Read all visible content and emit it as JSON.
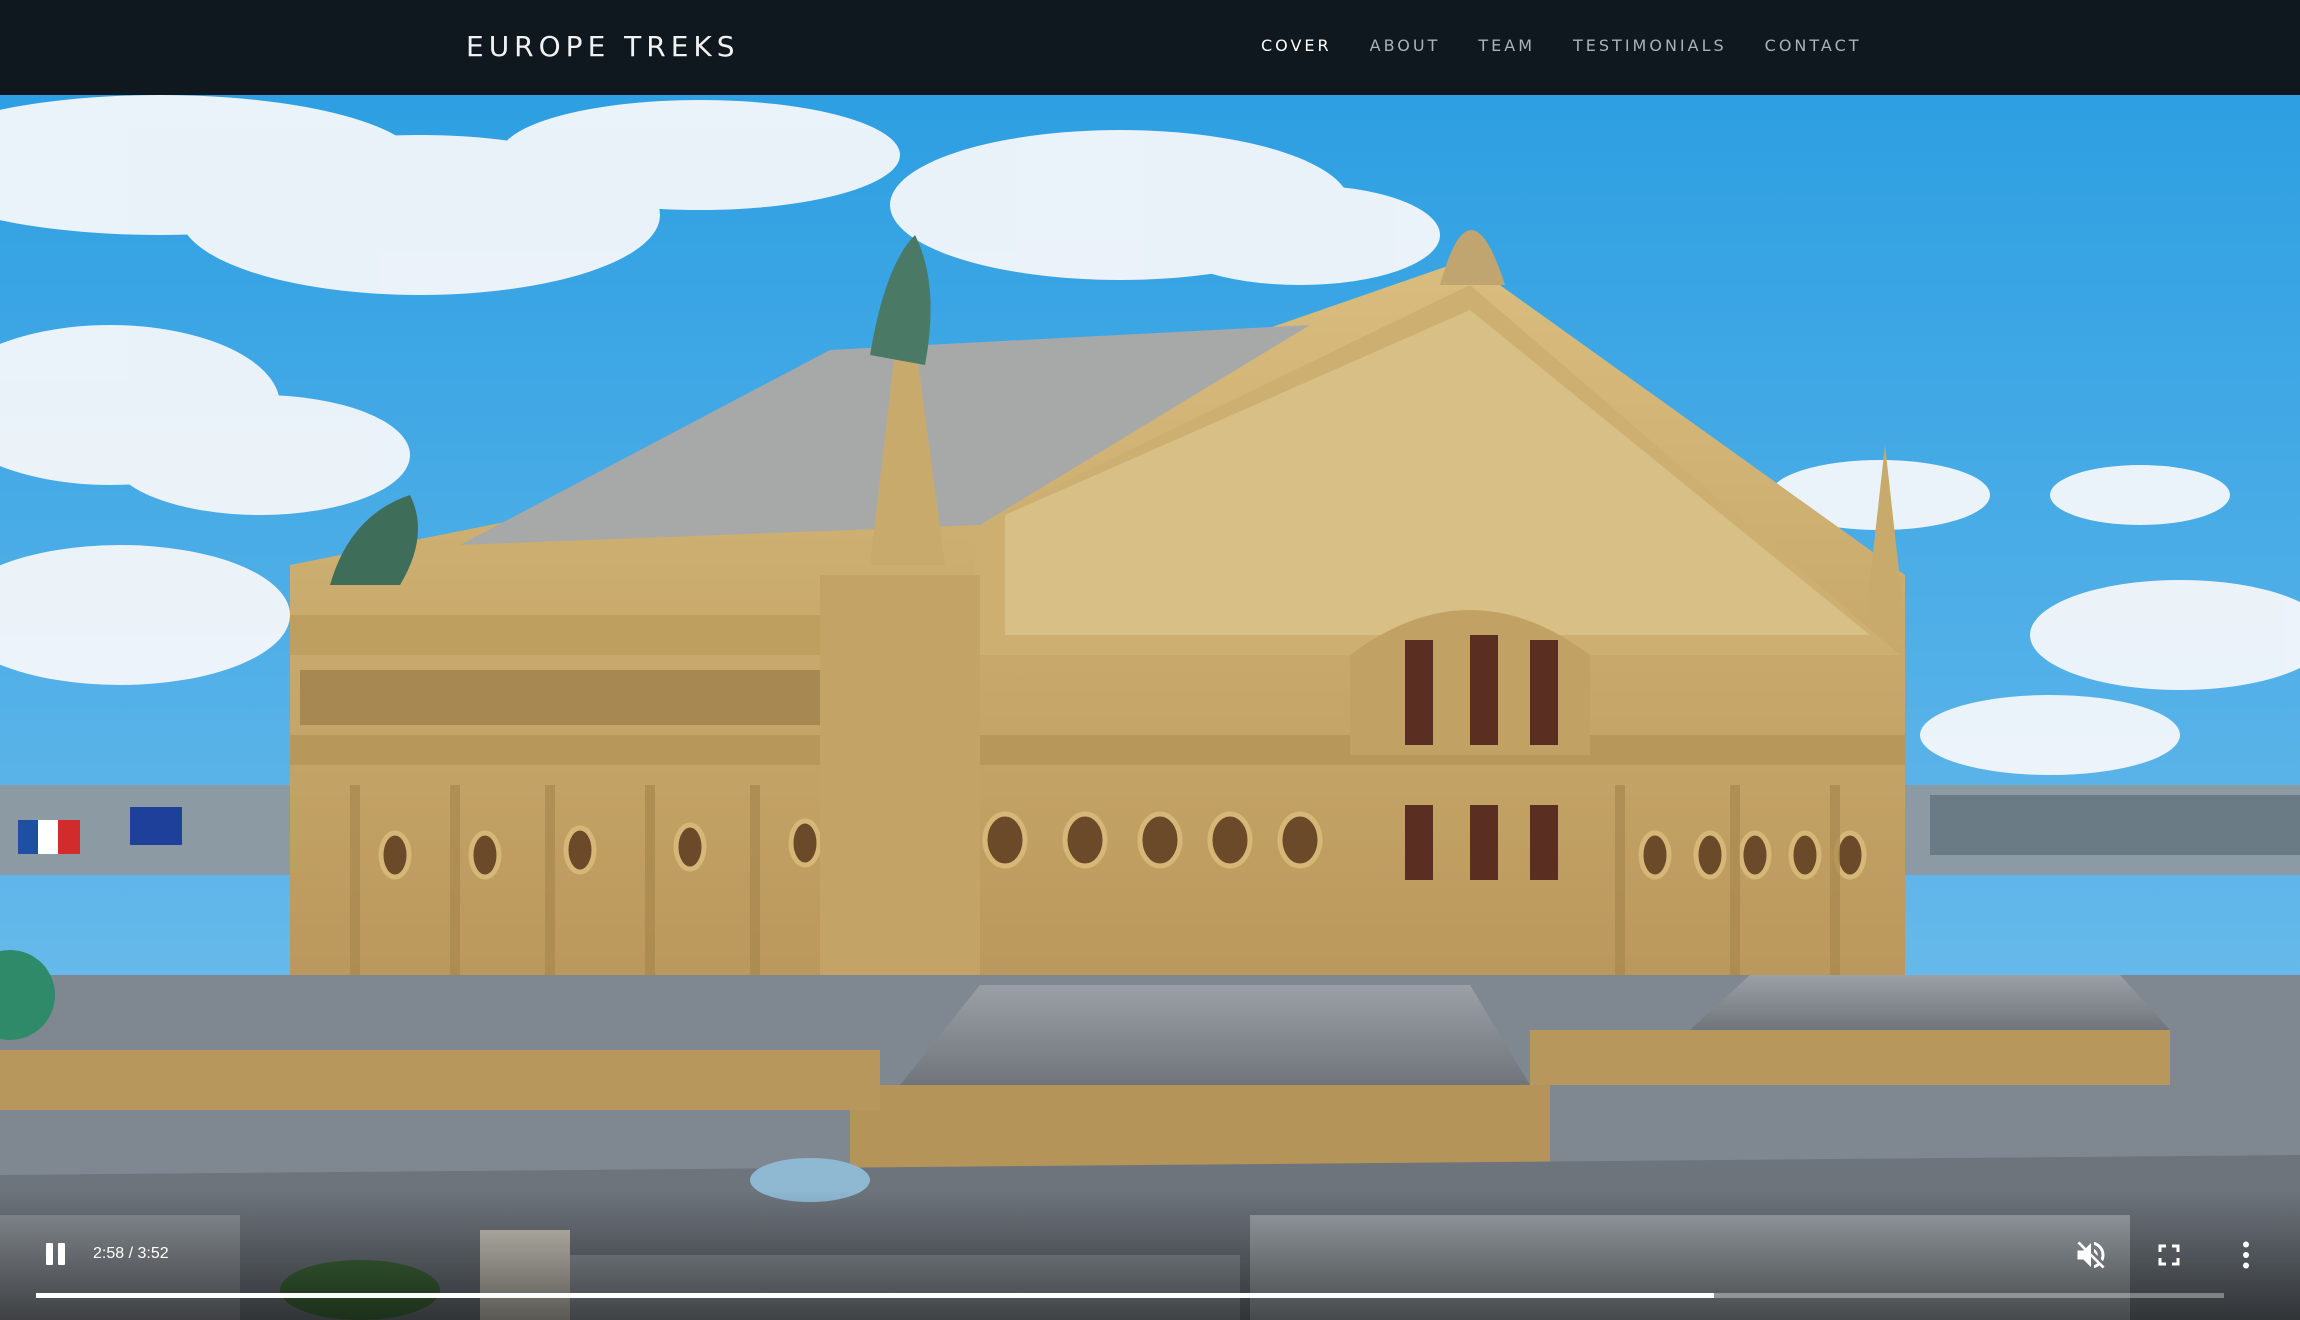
{
  "header": {
    "brand": "EUROPE TREKS",
    "nav": [
      {
        "label": "COVER",
        "active": true
      },
      {
        "label": "ABOUT",
        "active": false
      },
      {
        "label": "TEAM",
        "active": false
      },
      {
        "label": "TESTIMONIALS",
        "active": false
      },
      {
        "label": "CONTACT",
        "active": false
      }
    ]
  },
  "video": {
    "current_time": "2:58",
    "duration": "3:52",
    "time_display": "2:58 / 3:52",
    "progress_fraction": 0.767,
    "state": "playing",
    "muted": true,
    "icons": [
      "pause-icon",
      "muted-volume-icon",
      "fullscreen-icon",
      "more-vert-icon"
    ]
  },
  "colors": {
    "navbar": "#0f181f",
    "nav_active": "#ffffff",
    "nav_inactive": "#a9b2ba",
    "sky": "#3aa4e3",
    "stone": "#c9a866"
  }
}
